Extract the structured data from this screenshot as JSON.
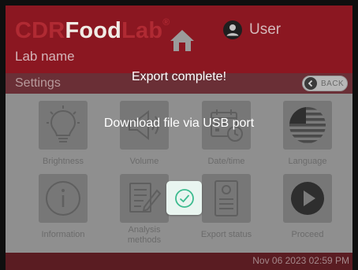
{
  "header": {
    "brand_pre": "CDR",
    "brand_main": "Food",
    "brand_post": "Lab",
    "brand_mark": "®",
    "user_label": "User",
    "lab_name": "Lab name"
  },
  "settings_bar": {
    "title": "Settings",
    "back_label": "BACK"
  },
  "tiles": [
    {
      "label": "Brightness",
      "icon": "lightbulb-icon"
    },
    {
      "label": "Volume",
      "icon": "speaker-icon"
    },
    {
      "label": "Date/time",
      "icon": "calendar-clock-icon"
    },
    {
      "label": "Language",
      "icon": "us-flag-icon"
    },
    {
      "label": "Information",
      "icon": "info-icon"
    },
    {
      "label": "Analysis\nmethods",
      "label_line1": "Analysis",
      "label_line2": "methods",
      "icon": "document-pen-icon"
    },
    {
      "label": "Export status",
      "icon": "export-document-icon"
    },
    {
      "label": "Proceed",
      "icon": "play-icon"
    }
  ],
  "footer": {
    "datetime": "Nov 06 2023 02:59 PM"
  },
  "dialog": {
    "title": "Export complete!",
    "message": "Download file via USB port",
    "ok_icon": "check-circle-icon"
  },
  "colors": {
    "header": "#8b1721",
    "brand_accent": "#b02a33",
    "screen_dim": "#8f8f8f",
    "ok_button": "#e9f5f0",
    "ok_check": "#3dbb8f"
  }
}
